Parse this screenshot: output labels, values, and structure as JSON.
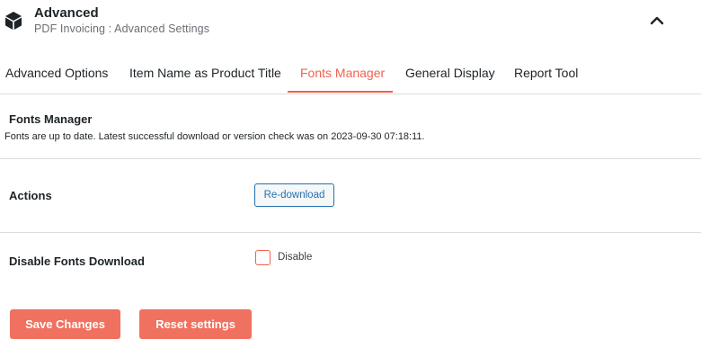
{
  "header": {
    "title": "Advanced",
    "subtitle": "PDF Invoicing : Advanced Settings",
    "logo_icon": "cube-icon",
    "collapse_icon": "chevron-up-icon"
  },
  "tabs": [
    {
      "label": "Advanced Options",
      "active": false
    },
    {
      "label": "Item Name as Product Title",
      "active": false
    },
    {
      "label": "Fonts Manager",
      "active": true
    },
    {
      "label": "General Display",
      "active": false
    },
    {
      "label": "Report Tool",
      "active": false
    }
  ],
  "section": {
    "title": "Fonts Manager",
    "description": "Fonts are up to date. Latest successful download or version check was on 2023-09-30 07:18:11."
  },
  "actions": {
    "label": "Actions",
    "button_label": "Re-download"
  },
  "disable_download": {
    "label": "Disable Fonts Download",
    "checkbox_label": "Disable",
    "checked": false
  },
  "footer": {
    "save_label": "Save Changes",
    "reset_label": "Reset settings"
  },
  "colors": {
    "accent": "#f0624f",
    "button_primary": "#f0715f",
    "link_blue": "#2271b1"
  }
}
